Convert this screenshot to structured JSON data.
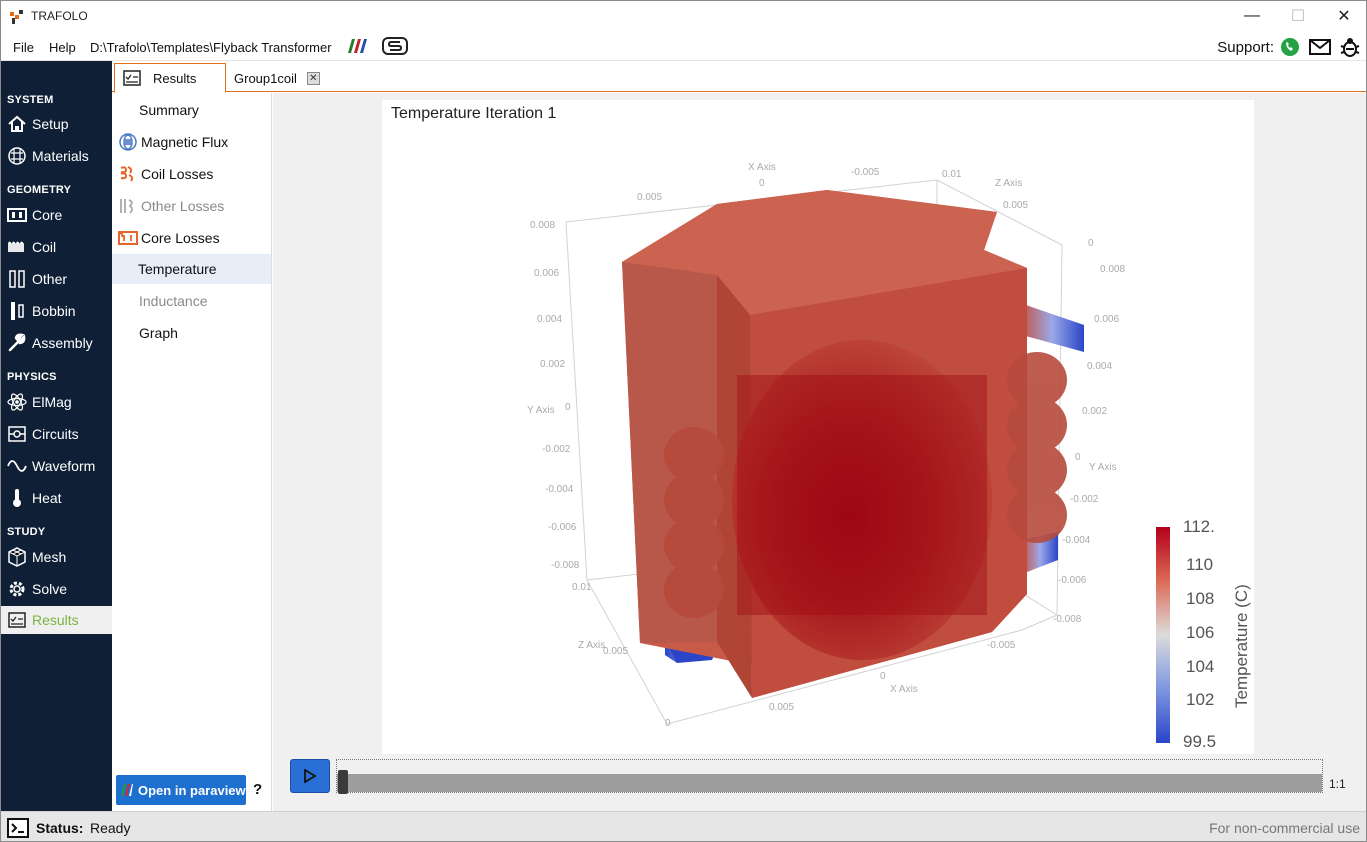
{
  "window": {
    "title": "TRAFOLO",
    "minimize": "—",
    "maximize": "☐",
    "close": "✕"
  },
  "menu": {
    "file": "File",
    "help": "Help",
    "path": "D:\\Trafolo\\Templates\\Flyback Transformer",
    "support_label": "Support:"
  },
  "nav": {
    "sections": {
      "system": "SYSTEM",
      "geometry": "GEOMETRY",
      "physics": "PHYSICS",
      "study": "STUDY"
    },
    "items": [
      {
        "label": "Setup",
        "icon": "home-icon"
      },
      {
        "label": "Materials",
        "icon": "grid-icon"
      },
      {
        "label": "Core",
        "icon": "core-icon"
      },
      {
        "label": "Coil",
        "icon": "coil-icon"
      },
      {
        "label": "Other",
        "icon": "other-icon"
      },
      {
        "label": "Bobbin",
        "icon": "bobbin-icon"
      },
      {
        "label": "Assembly",
        "icon": "wrench-icon"
      },
      {
        "label": "ElMag",
        "icon": "atom-icon"
      },
      {
        "label": "Circuits",
        "icon": "circuit-icon"
      },
      {
        "label": "Waveform",
        "icon": "wave-icon"
      },
      {
        "label": "Heat",
        "icon": "thermometer-icon"
      },
      {
        "label": "Mesh",
        "icon": "mesh-icon"
      },
      {
        "label": "Solve",
        "icon": "gear-icon"
      },
      {
        "label": "Results",
        "icon": "results-icon"
      }
    ]
  },
  "tabs": [
    {
      "label": "Results"
    },
    {
      "label": "Group1coil"
    }
  ],
  "subnav": {
    "items": [
      {
        "label": "Summary"
      },
      {
        "label": "Magnetic Flux"
      },
      {
        "label": "Coil Losses"
      },
      {
        "label": "Other Losses"
      },
      {
        "label": "Core Losses"
      },
      {
        "label": "Temperature"
      },
      {
        "label": "Inductance"
      },
      {
        "label": "Graph"
      }
    ],
    "paraview_button": "Open in paraview",
    "help": "?"
  },
  "viewer": {
    "title": "Temperature Iteration 1",
    "colorbar": {
      "title": "Temperature (C)",
      "ticks": [
        "112.",
        "110",
        "108",
        "106",
        "104",
        "102",
        "99.5"
      ],
      "colors": {
        "max": "#b3001b",
        "mid": "#dcdcdc",
        "min": "#2a45c8"
      }
    },
    "axes": {
      "x_label": "X Axis",
      "y_label": "Y Axis",
      "z_label": "Z Axis",
      "x_ticks_top": [
        "0.005",
        "0",
        "-0.005",
        "0.01"
      ],
      "x_ticks_bottom": [
        "0.005",
        "0",
        "-0.005"
      ],
      "z_ticks_top": [
        "0.005",
        "0"
      ],
      "z_ticks_left": [
        "0.01",
        "0.005",
        "0"
      ],
      "y_ticks_left": [
        "0.008",
        "0.006",
        "0.004",
        "0.002",
        "0",
        "-0.002",
        "-0.004",
        "-0.006",
        "-0.008"
      ],
      "y_ticks_right": [
        "0.008",
        "0.006",
        "0.004",
        "0.002",
        "0",
        "-0.002",
        "-0.004",
        "-0.006",
        "-0.008"
      ]
    }
  },
  "timeline": {
    "frame": "1:1",
    "progress": 0
  },
  "status": {
    "label": "Status:",
    "value": "Ready",
    "license": "For non-commercial use"
  }
}
